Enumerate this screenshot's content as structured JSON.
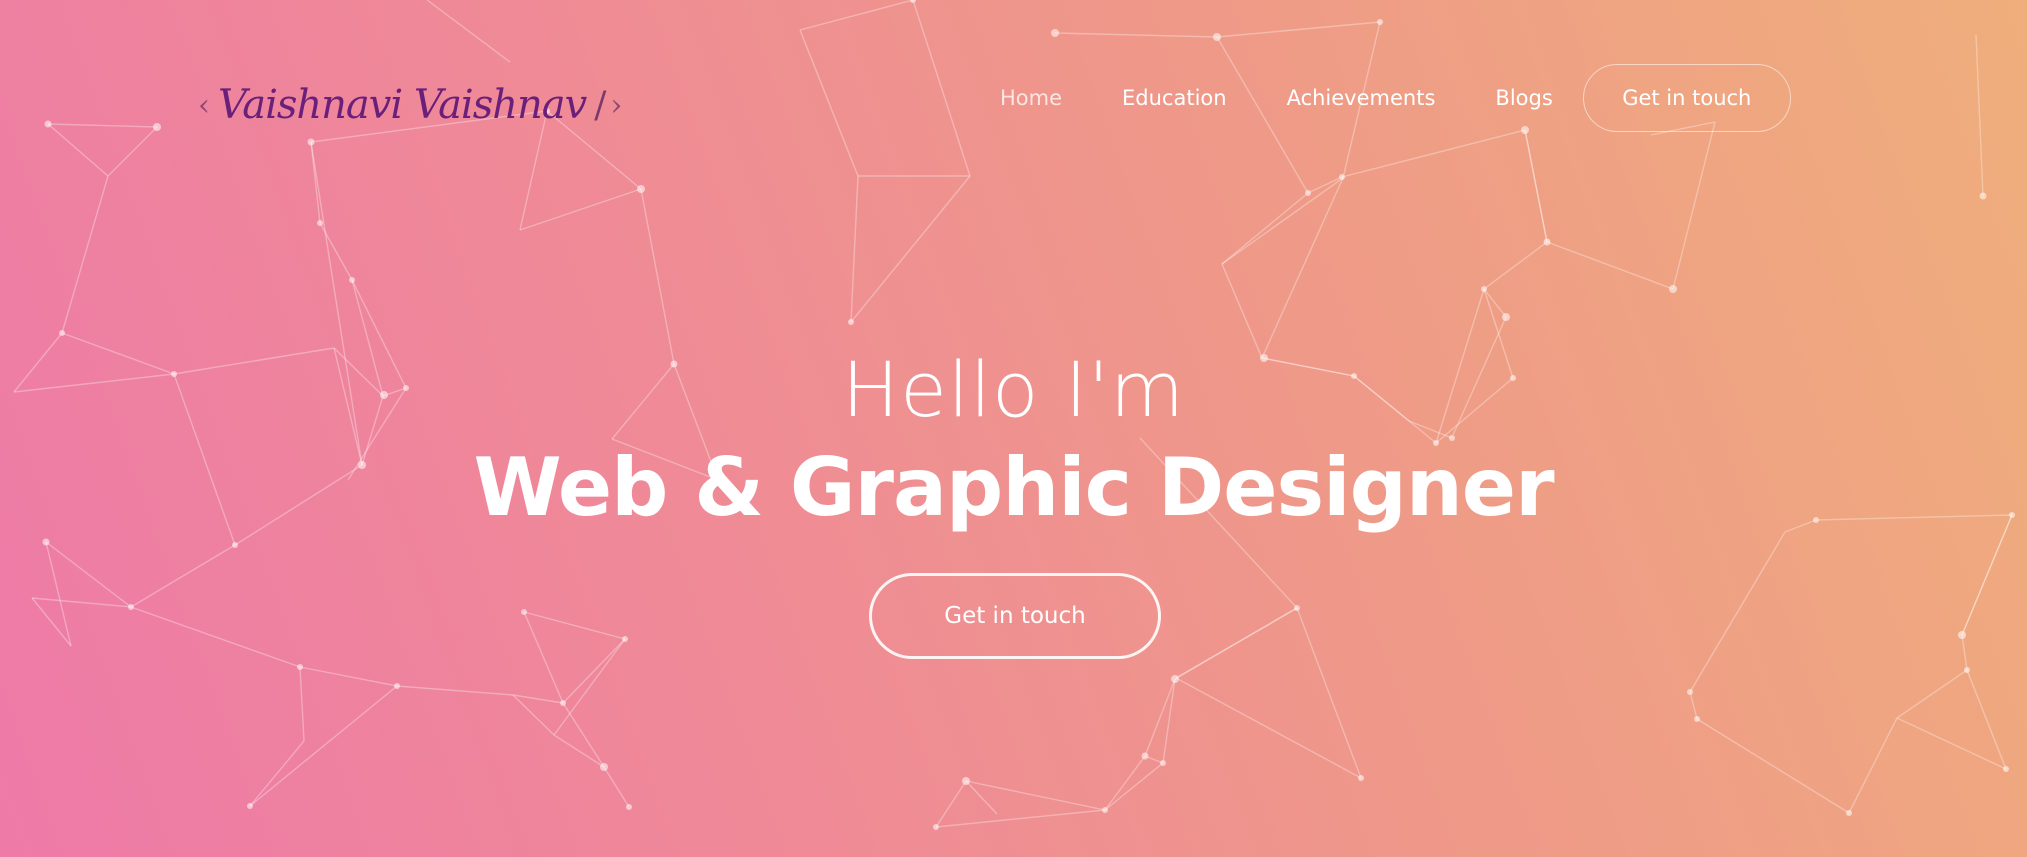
{
  "logo": {
    "open_bracket": "‹",
    "name": "Vaishnavi Vaishnav",
    "slash": "/",
    "close_bracket": "›"
  },
  "nav": {
    "items": [
      {
        "label": "Home",
        "active": true
      },
      {
        "label": "Education",
        "active": false
      },
      {
        "label": "Achievements",
        "active": false
      },
      {
        "label": "Blogs",
        "active": false
      }
    ],
    "cta_label": "Get in touch"
  },
  "hero": {
    "greeting": "Hello I'm",
    "title": "Web & Graphic Designer",
    "cta_label": "Get in touch"
  },
  "colors": {
    "gradient_start": "#ee7aa8",
    "gradient_end": "#efae7c",
    "logo_text": "#6a1f7a",
    "text": "#ffffff"
  }
}
